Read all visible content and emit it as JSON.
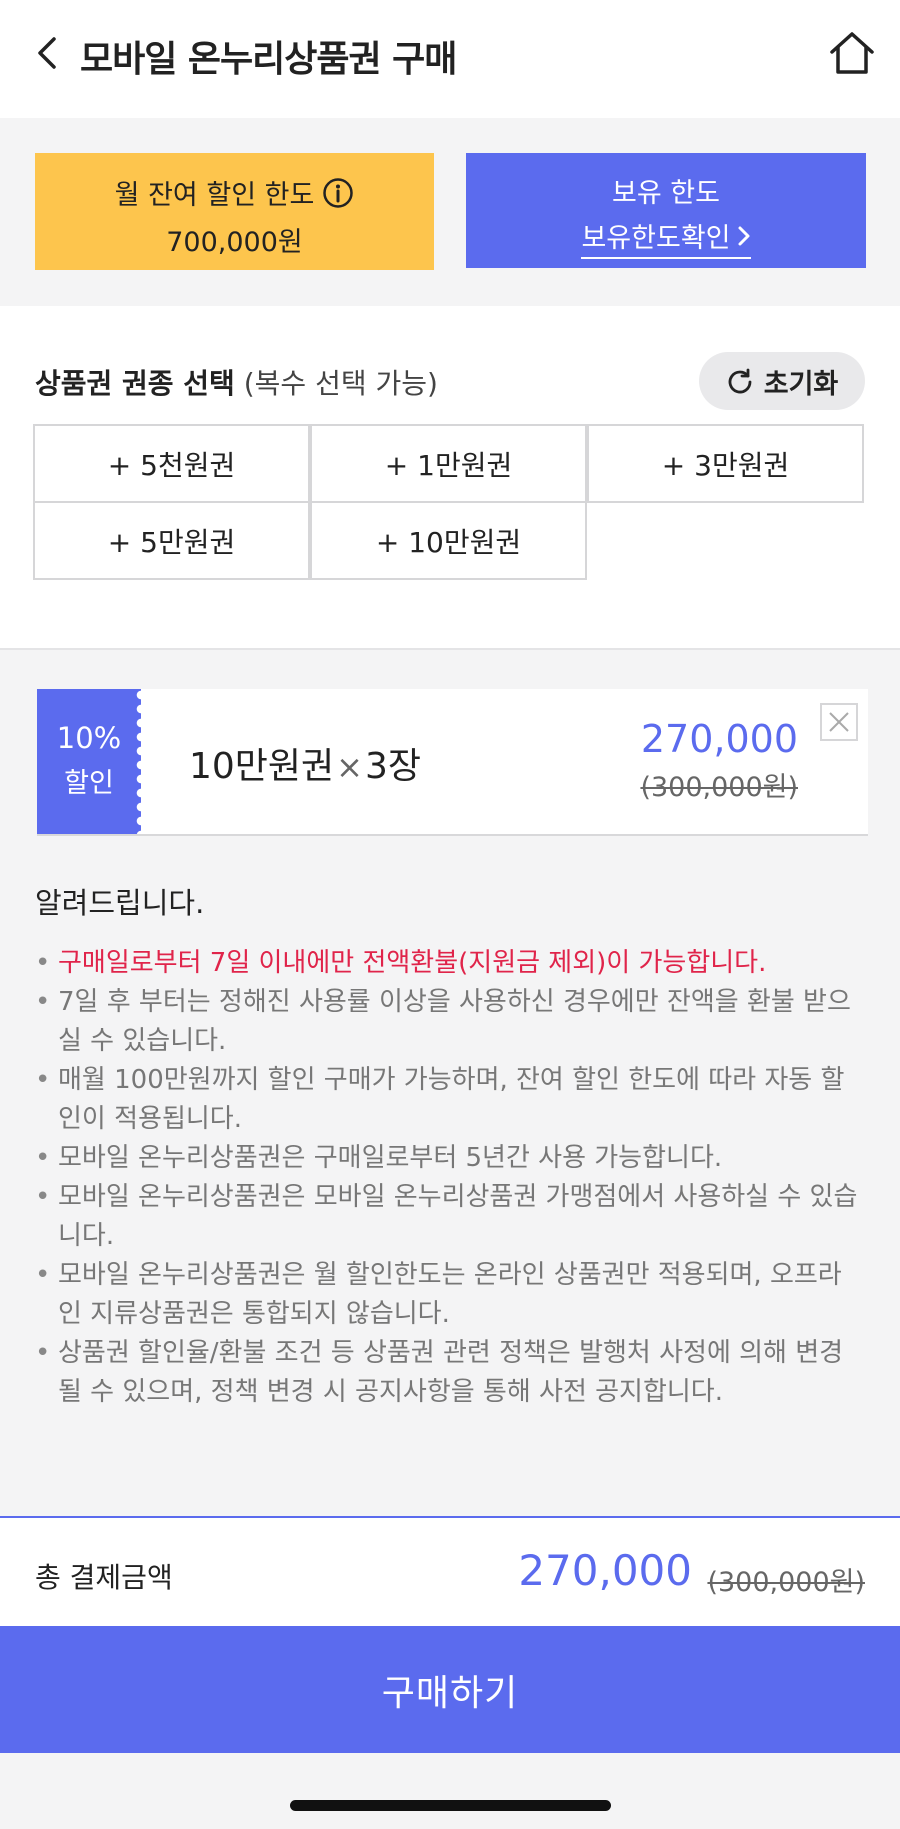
{
  "header": {
    "title": "모바일 온누리상품권 구매",
    "back_icon": "chevron-left-icon",
    "home_icon": "home-icon"
  },
  "limits": {
    "monthly_label": "월 잔여 할인 한도",
    "monthly_value": "700,000원",
    "held_label": "보유 한도",
    "held_link": "보유한도확인"
  },
  "selection": {
    "title_strong": "상품권 권종 선택",
    "title_sub": "(복수 선택 가능)",
    "reset_label": "초기화",
    "options": [
      "+ 5천원권",
      "+ 1만원권",
      "+ 3만원권",
      "+ 5만원권",
      "+ 10만원권"
    ]
  },
  "cart": {
    "discount_percent": "10%",
    "discount_label": "할인",
    "item_name": "10만원권",
    "item_times": "×",
    "item_qty": "3장",
    "price": "270,000",
    "original_price": "(300,000원)"
  },
  "notice": {
    "title": "알려드립니다.",
    "items": [
      "구매일로부터 7일 이내에만 전액환불(지원금 제외)이 가능합니다.",
      "7일 후 부터는 정해진 사용률 이상을 사용하신 경우에만 잔액을 환불 받으실 수 있습니다.",
      "매월 100만원까지 할인 구매가 가능하며, 잔여 할인 한도에 따라 자동 할인이 적용됩니다.",
      "모바일 온누리상품권은 구매일로부터 5년간 사용 가능합니다.",
      "모바일 온누리상품권은 모바일 온누리상품권 가맹점에서 사용하실 수 있습니다.",
      "모바일 온누리상품권은 월 할인한도는 온라인 상품권만 적용되며, 오프라인 지류상품권은 통합되지 않습니다.",
      "상품권 할인율/환불 조건 등 상품권 관련 정책은 발행처 사정에 의해 변경될 수 있으며, 정책 변경 시 공지사항을 통해 사전 공지합니다."
    ]
  },
  "total": {
    "label": "총 결제금액",
    "amount": "270,000",
    "original": "(300,000원)"
  },
  "buy_button": "구매하기",
  "colors": {
    "accent": "#5b6bee",
    "yellow": "#fdc54d",
    "warning_red": "#e0244a"
  }
}
